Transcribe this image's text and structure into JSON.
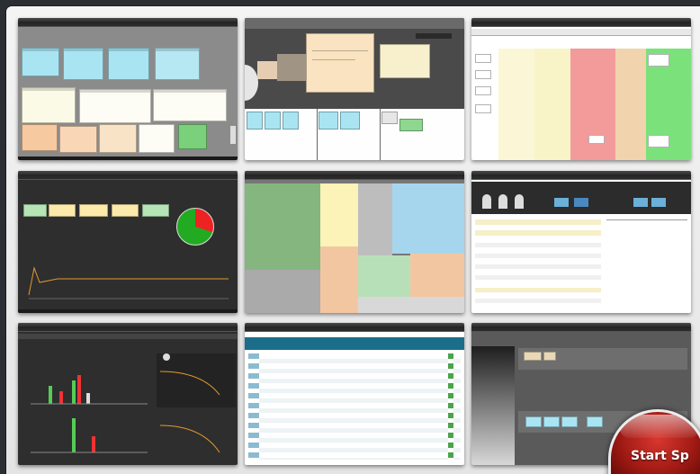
{
  "start_button": {
    "label": "Start Sp",
    "icon": "start-button"
  },
  "colors": {
    "page_bg": "#2b2e33",
    "frame_bg": "#f0f0f0",
    "button_red": "#b5201a",
    "card_blue": "#a9e4f2",
    "card_peach": "#f7c9a0",
    "card_yellow": "#fbf6c2",
    "card_green": "#8fd68f",
    "lane_red": "#f39b9b",
    "lane_green": "#7be27b"
  },
  "screenshots": [
    {
      "name": "card-wall-view"
    },
    {
      "name": "floating-cards-view"
    },
    {
      "name": "swimlane-board-view"
    },
    {
      "name": "dashboard-pie-view"
    },
    {
      "name": "treemap-view"
    },
    {
      "name": "team-table-view"
    },
    {
      "name": "bar-chart-report-view"
    },
    {
      "name": "list-table-view"
    },
    {
      "name": "planning-board-view"
    }
  ]
}
